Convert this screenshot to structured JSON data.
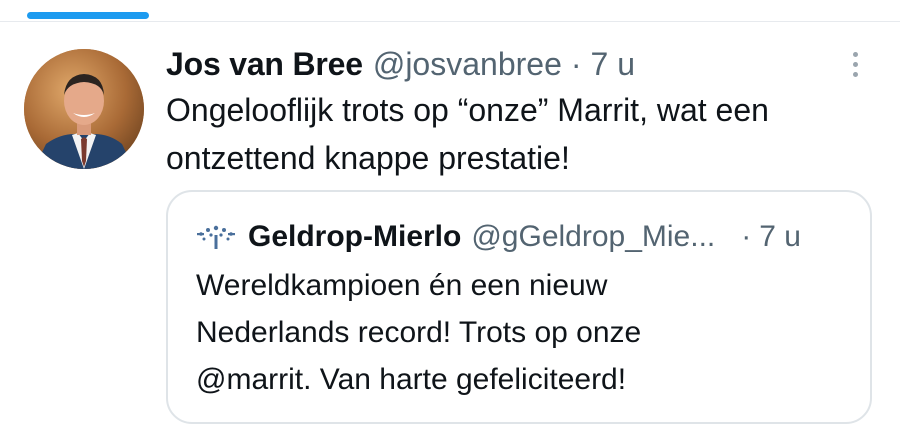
{
  "tweet": {
    "author_name": "Jos van Bree",
    "author_handle": "@josvanbree",
    "separator": "·",
    "timestamp": "7 u",
    "avatar_icon": "user-avatar-photo",
    "text_line1": "Ongelooflijk trots op “onze” Marrit, wat een",
    "text_line2": "ontzettend knappe prestatie!"
  },
  "quote": {
    "logo_icon": "geldrop-mierlo-logo",
    "author_name": "Geldrop-Mierlo",
    "author_handle": "@gGeldrop_Mie...",
    "separator": "·",
    "timestamp": "7 u",
    "text_line1": "Wereldkampioen én een nieuw",
    "text_line2": "Nederlands record! Trots op onze",
    "text_line3": "@marrit. Van harte gefeliciteerd!"
  },
  "colors": {
    "accent": "#1d9bf0",
    "text_primary": "#0f1419",
    "text_secondary": "#536471",
    "border": "#dfe4e8"
  }
}
